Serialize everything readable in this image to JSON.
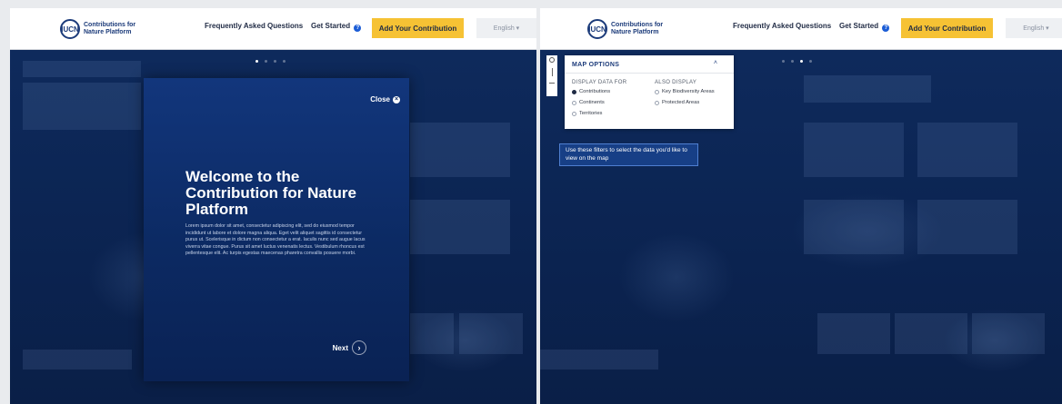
{
  "brand": {
    "abbr": "IUCN",
    "name": "Contributions for Nature Platform"
  },
  "nav": {
    "faq": "Frequently Asked Questions",
    "get_started": "Get Started",
    "help_glyph": "?",
    "contribute": "Add Your Contribution",
    "language": "English ▾"
  },
  "welcome": {
    "close": "Close",
    "close_glyph": "×",
    "title": "Welcome to the Contribution for Nature Platform",
    "body": "Lorem ipsum dolor sit amet, consectetur adipiscing elit, sed do eiusmod tempor incididunt ut labore et dolore magna aliqua. Eget velit aliquet sagittis id consectetur purus ut. Scelerisque in dictum non consectetur a erat. Iaculis nunc sed augue lacus viverra vitae congue. Purus sit amet luctus venenatis lectus. Vestibulum rhoncus est pellentesque elit. Ac turpis egestas maecenas pharetra convallis posuere morbi.",
    "next": "Next",
    "next_glyph": "›"
  },
  "map_options": {
    "title": "MAP OPTIONS",
    "caret": "˄",
    "display_title": "DISPLAY DATA FOR",
    "display_options": [
      "Contributions",
      "Continents",
      "Territories"
    ],
    "also_title": "ALSO DISPLAY",
    "also_options": [
      "Key Biodiversity Areas",
      "Protected Areas"
    ],
    "tip": "Use these filters to select the data you'd like to view on the map"
  },
  "carousel": {
    "left_active_step": 1,
    "right_active_step": 3,
    "total_steps": 4
  },
  "colors": {
    "navy": "#0b2350",
    "accent": "#f6c234",
    "brand_blue": "#1c3b7a",
    "link_blue": "#1c5dd6"
  },
  "icons": [
    "iucn-logo-icon",
    "help-icon",
    "close-icon",
    "next-arrow-icon",
    "globe-icon",
    "chevron-up-icon",
    "radio-icon"
  ]
}
